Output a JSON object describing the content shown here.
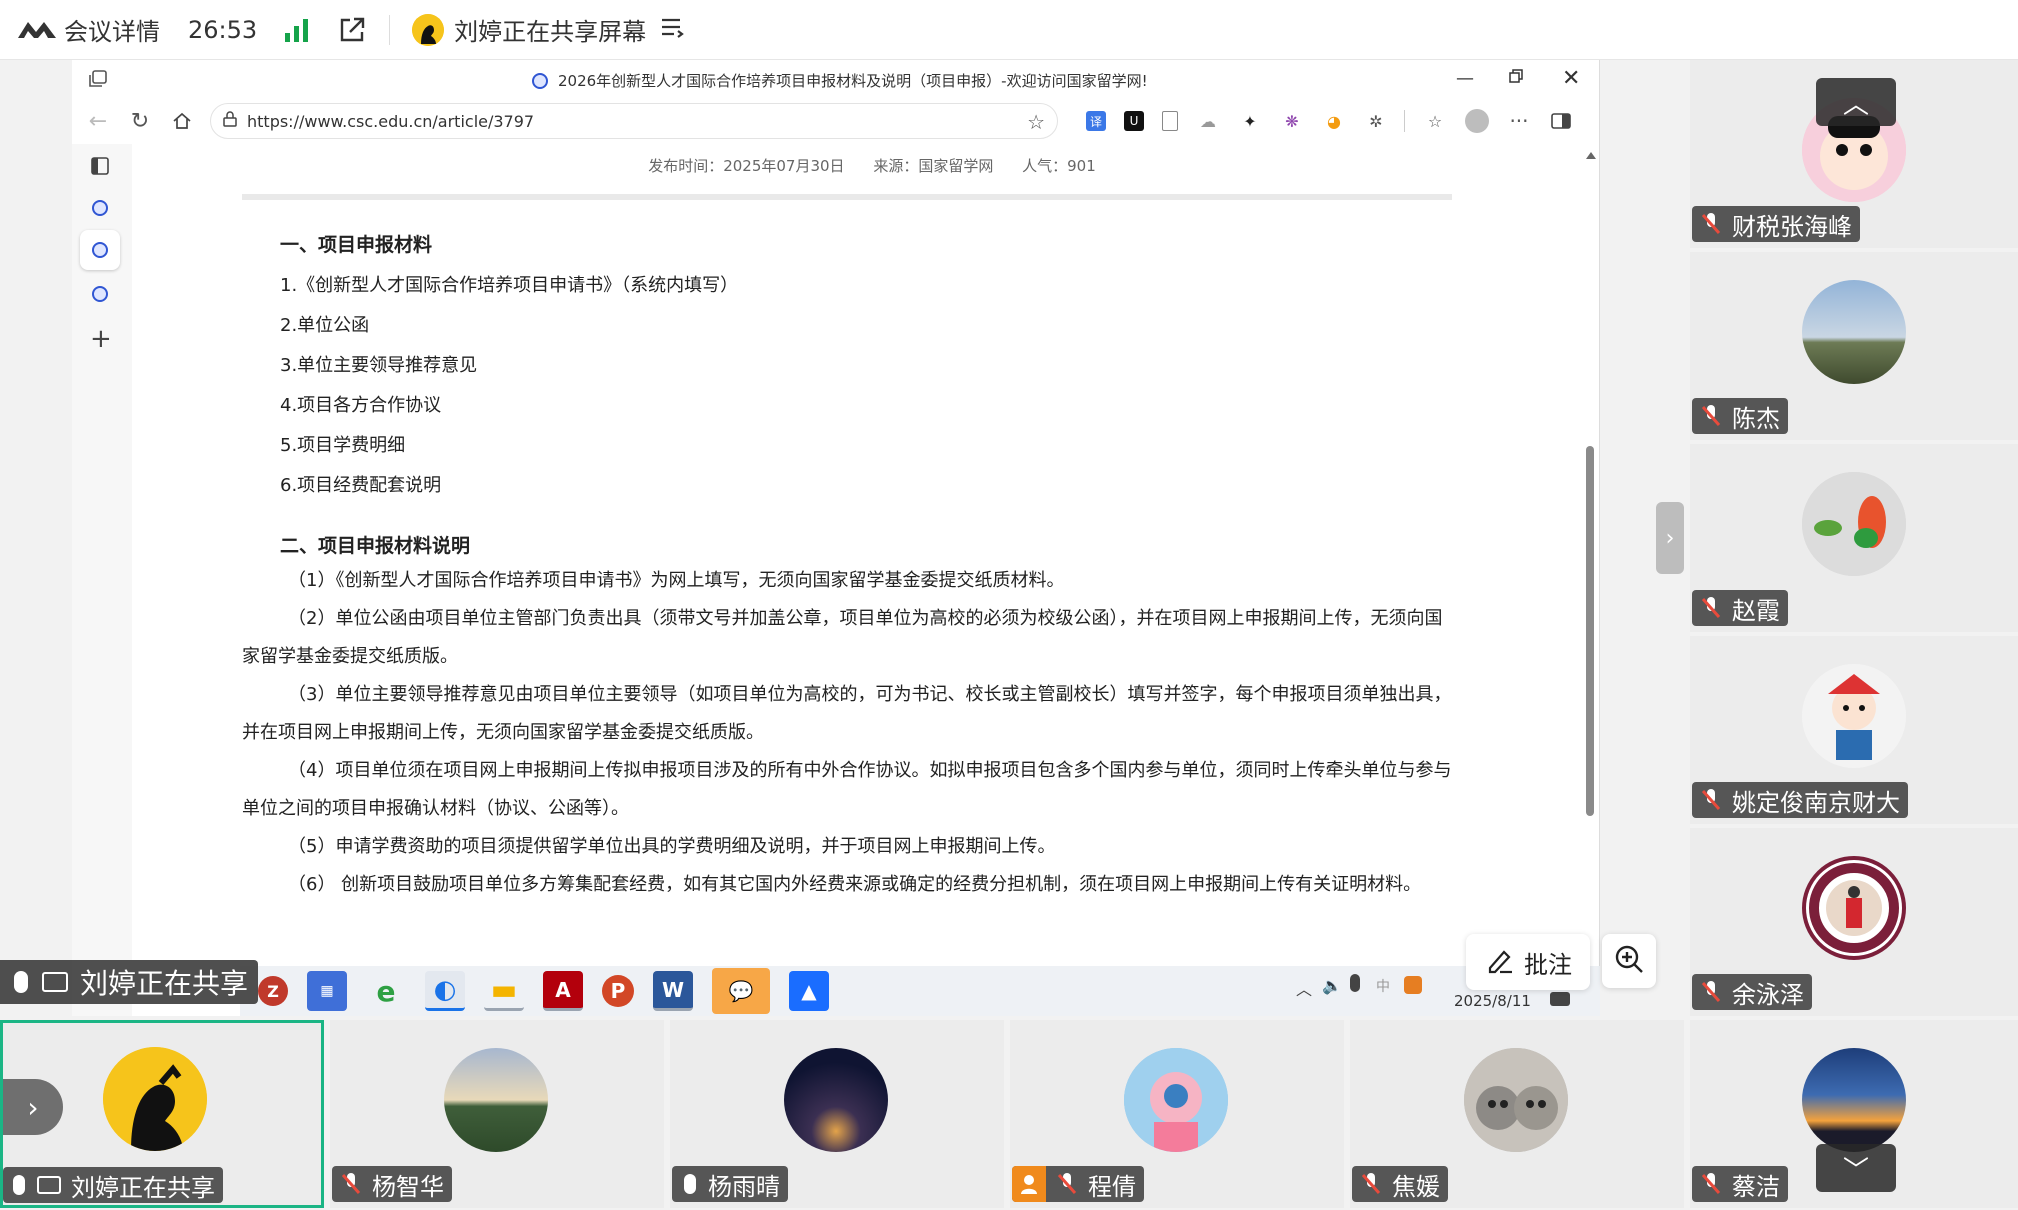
{
  "topbar": {
    "meeting_details": "会议详情",
    "timer": "26:53",
    "sharing_status": "刘婷正在共享屏幕"
  },
  "browser": {
    "window_title": "2026年创新型人才国际合作培养项目申报材料及说明（项目申报）-欢迎访问国家留学网!",
    "url": "https://www.csc.edu.cn/article/3797"
  },
  "article": {
    "meta": {
      "published": "发布时间：2025年07月30日",
      "source": "来源：国家留学网",
      "views": "人气：901"
    },
    "section1_title": "一、项目申报材料",
    "materials": [
      "1.《创新型人才国际合作培养项目申请书》（系统内填写）",
      "2.单位公函",
      "3.单位主要领导推荐意见",
      "4.项目各方合作协议",
      "5.项目学费明细",
      "6.项目经费配套说明"
    ],
    "section2_title": "二、项目申报材料说明",
    "notes": [
      "（1）《创新型人才国际合作培养项目申请书》为网上填写，无须向国家留学基金委提交纸质材料。",
      "（2）单位公函由项目单位主管部门负责出具（须带文号并加盖公章，项目单位为高校的必须为校级公函），并在项目网上申报期间上传，无须向国家留学基金委提交纸质版。",
      "（3）单位主要领导推荐意见由项目单位主要领导（如项目单位为高校的，可为书记、校长或主管副校长）填写并签字，每个申报项目须单独出具，并在项目网上申报期间上传，无须向国家留学基金委提交纸质版。",
      "（4）项目单位须在项目网上申报期间上传拟申报项目涉及的所有中外合作协议。如拟申报项目包含多个国内参与单位，须同时上传牵头单位与参与单位之间的项目申报确认材料（协议、公函等）。",
      "（5）申请学费资助的项目须提供留学单位出具的学费明细及说明，并于项目网上申报期间上传。",
      "（6） 创新项目鼓励项目单位多方筹集配套经费，如有其它国内外经费来源或确定的经费分担机制，须在项目网上申报期间上传有关证明材料。"
    ]
  },
  "taskbar": {
    "date": "2025/8/11"
  },
  "floating": {
    "annotate_label": "批注"
  },
  "sharer_banner": "刘婷正在共享",
  "right_participants": [
    {
      "name": "财税张海峰"
    },
    {
      "name": "陈杰"
    },
    {
      "name": "赵霞"
    },
    {
      "name": "姚定俊南京财大"
    },
    {
      "name": "余泳泽"
    }
  ],
  "bottom_participants": [
    {
      "name": "刘婷正在共享"
    },
    {
      "name": "杨智华"
    },
    {
      "name": "杨雨晴"
    },
    {
      "name": "程倩"
    },
    {
      "name": "焦媛"
    },
    {
      "name": "蔡洁"
    }
  ],
  "colors": {
    "active_border": "#1bb585",
    "signal_green": "#15a34a",
    "nametag_bg": "#3c3c3c",
    "mic_off_red": "#e84b3c"
  }
}
